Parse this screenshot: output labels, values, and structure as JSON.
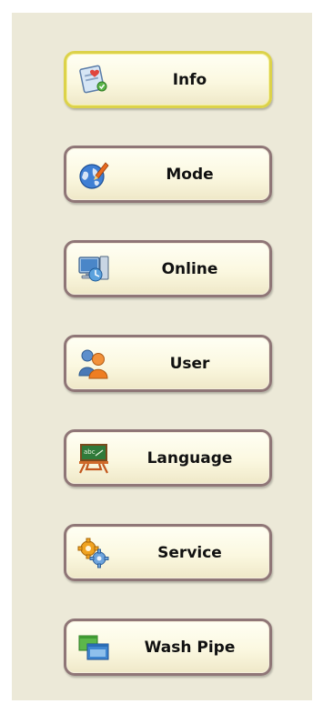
{
  "menu": {
    "items": [
      {
        "label": "Info",
        "icon": "info-clipboard-icon",
        "active": true
      },
      {
        "label": "Mode",
        "icon": "mode-globe-pen-icon",
        "active": false
      },
      {
        "label": "Online",
        "icon": "online-computer-icon",
        "active": false
      },
      {
        "label": "User",
        "icon": "users-icon",
        "active": false
      },
      {
        "label": "Language",
        "icon": "language-chalkboard-icon",
        "active": false
      },
      {
        "label": "Service",
        "icon": "service-gears-icon",
        "active": false
      },
      {
        "label": "Wash Pipe",
        "icon": "wash-pipe-windows-icon",
        "active": false
      }
    ]
  },
  "colors": {
    "panel": "#ece9d8",
    "button_border": "#8f7677",
    "active_border": "#dcd24a",
    "button_fill": "#fbf8e0"
  }
}
